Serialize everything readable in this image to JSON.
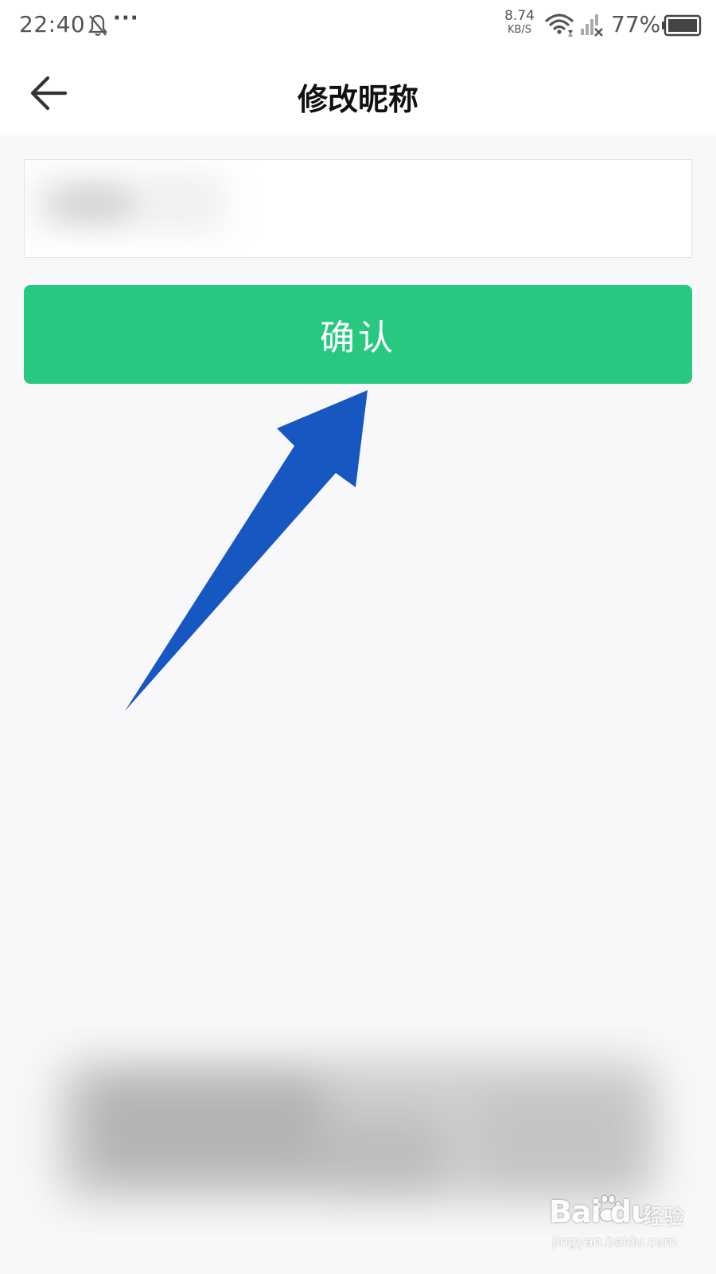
{
  "status_bar": {
    "time": "22:40",
    "extra": "···",
    "net_speed_value": "8.74",
    "net_speed_unit": "KB/S",
    "battery_percent": "77%"
  },
  "header": {
    "title": "修改昵称"
  },
  "form": {
    "nickname_value": "",
    "confirm_label": "确认"
  },
  "watermark": {
    "brand": "Bai  du",
    "sub": "经验",
    "url": "jingyan.baidu.com"
  },
  "colors": {
    "accent": "#27c980",
    "annotation_arrow": "#1757c2",
    "background": "#f8f8fa"
  }
}
